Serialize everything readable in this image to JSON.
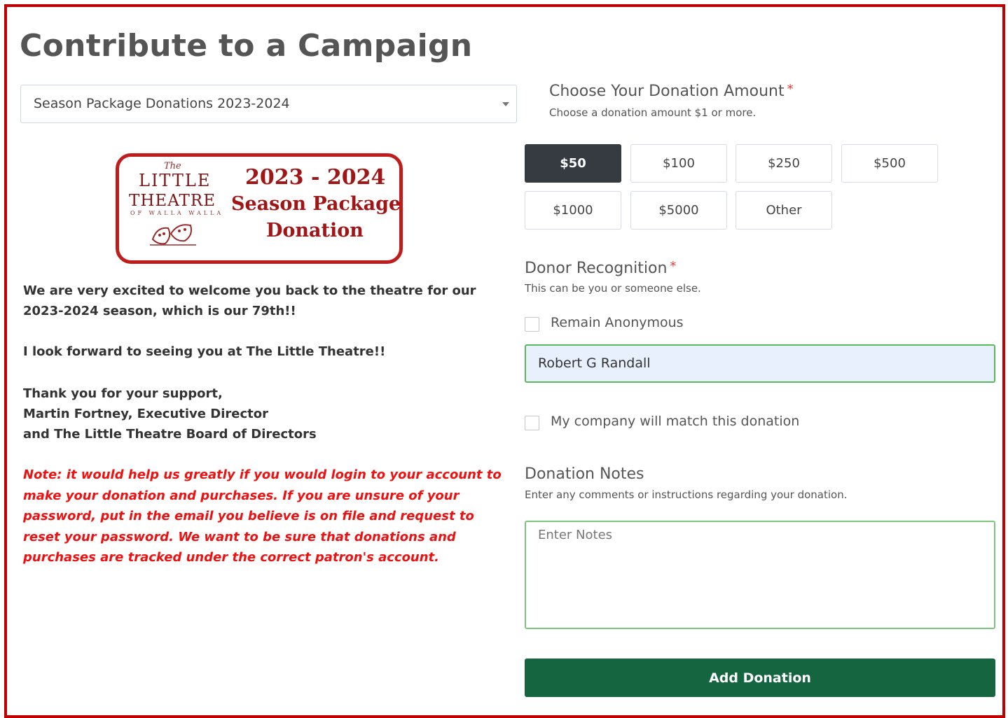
{
  "page": {
    "title": "Contribute to a Campaign",
    "campaign_select": {
      "value": "Season Package Donations 2023-2024"
    }
  },
  "banner": {
    "org_the": "The",
    "org_little": "LITTLE",
    "org_theatre": "THEATRE",
    "org_city": "OF WALLA WALLA",
    "years": "2023 - 2024",
    "line1": "Season Package",
    "line2": "Donation",
    "accent_color": "#c01c1c"
  },
  "message": {
    "welcome": "We are very excited to welcome you back to the theatre for our 2023-2024 season, which is our 79th!!",
    "forward": "I look forward to seeing you at The Little Theatre!!",
    "thanks": "Thank you for your support,",
    "signer": "Martin Fortney, Executive Director",
    "board": "and The Little Theatre Board of Directors",
    "note": "Note: it would help us greatly if you would login to your account to make your donation and purchases. If you are unsure of your password, put in the email you believe is on file and request to reset your password. We want to be sure that donations and purchases are tracked under the correct patron's account."
  },
  "amount": {
    "title": "Choose Your Donation Amount",
    "required_mark": "*",
    "help": "Choose a donation amount $1 or more.",
    "options": [
      "$50",
      "$100",
      "$250",
      "$500",
      "$1000",
      "$5000",
      "Other"
    ],
    "selected": "$50"
  },
  "recognition": {
    "title": "Donor Recognition",
    "required_mark": "*",
    "help": "This can be you or someone else.",
    "anonymous_label": "Remain Anonymous",
    "anonymous_checked": false,
    "donor_name": "Robert G Randall",
    "match_label": "My company will match this donation",
    "match_checked": false
  },
  "notes": {
    "title": "Donation Notes",
    "help": "Enter any comments or instructions regarding your donation.",
    "placeholder": "Enter Notes"
  },
  "submit_label": "Add Donation",
  "colors": {
    "frame": "#c00000",
    "note_text": "#ee1111",
    "selected_amount": "#353b40",
    "submit": "#166541",
    "valid_border": "#5cb85c",
    "autofill_bg": "#e8f0fe"
  }
}
